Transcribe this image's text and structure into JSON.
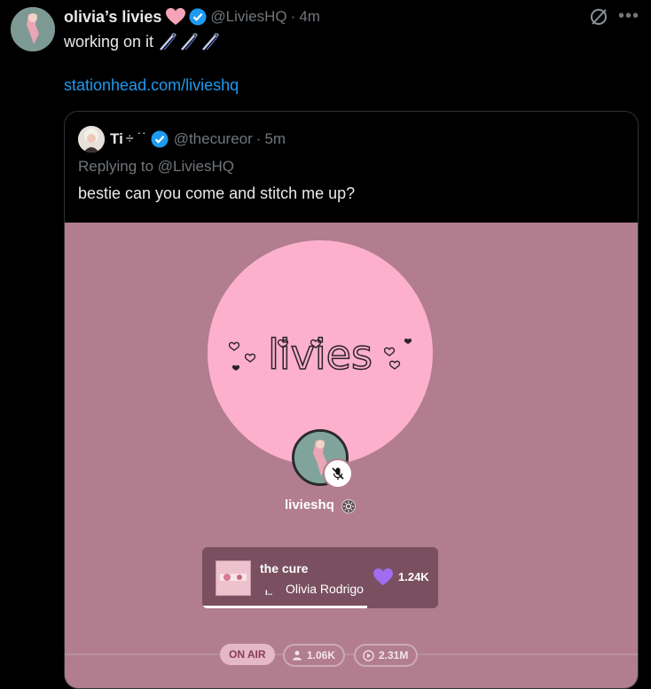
{
  "tweet": {
    "display_name": "olivia’s livies",
    "handle": "@LiviesHQ",
    "separator": "·",
    "time": "4m",
    "text": "working on it",
    "link": "stationhead.com/livieshq"
  },
  "quoted_tweet": {
    "display_name": "Ti",
    "name_symbols": "÷ ˙˙",
    "handle": "@thecureor",
    "separator": "·",
    "time": "5m",
    "replying_to": "Replying to @LiviesHQ",
    "text": "bestie can you come and stitch me up?"
  },
  "stationhead": {
    "logo_text": "livies",
    "host_name": "livieshq",
    "now_playing": {
      "title": "the cure",
      "artist": "Olivia Rodrigo",
      "likes": "1.24K",
      "progress": 0.7
    },
    "status_label": "ON AIR",
    "listeners": "1.06K",
    "plays": "2.31M"
  },
  "colors": {
    "link": "#1d9bf0",
    "media_bg": "#b17d8f",
    "circle_bg": "#fcb0cb",
    "heart": "#a06cf0"
  }
}
